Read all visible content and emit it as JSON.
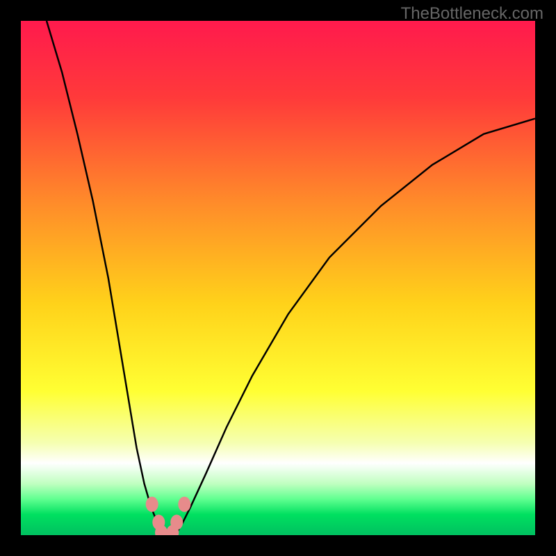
{
  "watermark": "TheBottleneck.com",
  "chart_data": {
    "type": "line",
    "title": "",
    "xlabel": "",
    "ylabel": "",
    "xlim": [
      0,
      100
    ],
    "ylim": [
      0,
      100
    ],
    "gradient_stops": [
      {
        "offset": 0.0,
        "color": "#ff1a4d"
      },
      {
        "offset": 0.15,
        "color": "#ff3a3a"
      },
      {
        "offset": 0.35,
        "color": "#ff8a2a"
      },
      {
        "offset": 0.55,
        "color": "#ffd21a"
      },
      {
        "offset": 0.72,
        "color": "#ffff33"
      },
      {
        "offset": 0.82,
        "color": "#f5ffb0"
      },
      {
        "offset": 0.86,
        "color": "#ffffff"
      },
      {
        "offset": 0.9,
        "color": "#c0ffc0"
      },
      {
        "offset": 0.93,
        "color": "#60ff90"
      },
      {
        "offset": 0.96,
        "color": "#00e060"
      },
      {
        "offset": 1.0,
        "color": "#00c060"
      }
    ],
    "series": [
      {
        "name": "left-branch",
        "x": [
          5,
          8,
          11,
          14,
          17,
          19,
          21,
          22.5,
          24,
          25.3,
          26.5,
          27.5
        ],
        "y": [
          100,
          90,
          78,
          65,
          50,
          38,
          26,
          17,
          10,
          5.5,
          2.5,
          0
        ]
      },
      {
        "name": "right-branch",
        "x": [
          30,
          31.5,
          33,
          36,
          40,
          45,
          52,
          60,
          70,
          80,
          90,
          100
        ],
        "y": [
          0,
          2.5,
          5.5,
          12,
          21,
          31,
          43,
          54,
          64,
          72,
          78,
          81
        ]
      },
      {
        "name": "floor",
        "x": [
          27.5,
          30
        ],
        "y": [
          0,
          0
        ]
      }
    ],
    "markers": [
      {
        "name": "dot-left-upper",
        "x": 25.5,
        "y": 6,
        "color": "#e78b8b"
      },
      {
        "name": "dot-left-lower",
        "x": 26.8,
        "y": 2.5,
        "color": "#e78b8b"
      },
      {
        "name": "dot-right-lower",
        "x": 30.3,
        "y": 2.5,
        "color": "#e78b8b"
      },
      {
        "name": "dot-right-upper",
        "x": 31.8,
        "y": 6,
        "color": "#e78b8b"
      },
      {
        "name": "dot-bottom-left",
        "x": 27.3,
        "y": 0.5,
        "color": "#e78b8b"
      },
      {
        "name": "dot-bottom-right",
        "x": 29.5,
        "y": 0.5,
        "color": "#e78b8b"
      }
    ]
  }
}
